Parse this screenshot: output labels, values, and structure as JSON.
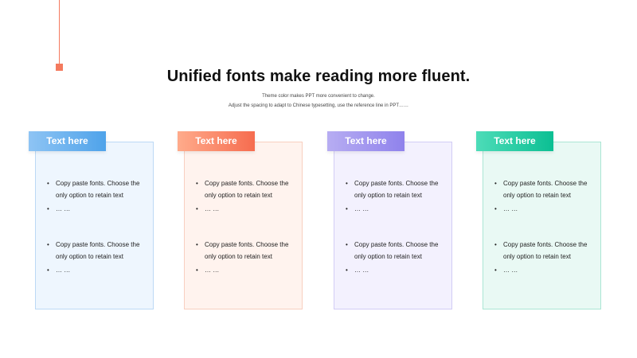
{
  "title": "Unified fonts make reading more fluent.",
  "subtitle_line1": "Theme color makes PPT more convenient to change.",
  "subtitle_line2": "Adjust the spacing to adapt to Chinese typesetting, use the reference line in PPT……",
  "colors": {
    "accent_line": "#f47a5e",
    "blue": "#4fa3ea",
    "orange": "#f66c4f",
    "purple": "#8f82ec",
    "green": "#0cbf93"
  },
  "cards": [
    {
      "header": "Text  here",
      "group1": [
        "Copy paste fonts. Choose the only option to retain text",
        "… …"
      ],
      "group2": [
        "Copy paste fonts. Choose the only option to retain text",
        "… …"
      ]
    },
    {
      "header": "Text  here",
      "group1": [
        "Copy paste fonts. Choose the only option to retain text",
        "… …"
      ],
      "group2": [
        "Copy paste fonts. Choose the only option to retain text",
        "… …"
      ]
    },
    {
      "header": "Text  here",
      "group1": [
        "Copy paste fonts. Choose the only option to retain text",
        "… …"
      ],
      "group2": [
        "Copy paste fonts. Choose the only option to retain text",
        "… …"
      ]
    },
    {
      "header": "Text  here",
      "group1": [
        "Copy paste fonts. Choose the only option to retain text",
        "… …"
      ],
      "group2": [
        "Copy paste fonts. Choose the only option to retain text",
        "… …"
      ]
    }
  ]
}
